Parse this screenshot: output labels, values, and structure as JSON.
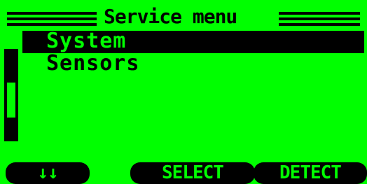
{
  "title": "Service menu",
  "menu": {
    "items": [
      {
        "label": "System",
        "selected": true
      },
      {
        "label": "Sensors",
        "selected": false
      }
    ]
  },
  "scrollbar": {
    "visible_fraction": 0.4,
    "position_fraction": 0.6
  },
  "softkeys": {
    "left": "↓↓",
    "middle": "SELECT",
    "right": "DETECT"
  },
  "colors": {
    "background": "#00ff00",
    "foreground": "#000000"
  }
}
